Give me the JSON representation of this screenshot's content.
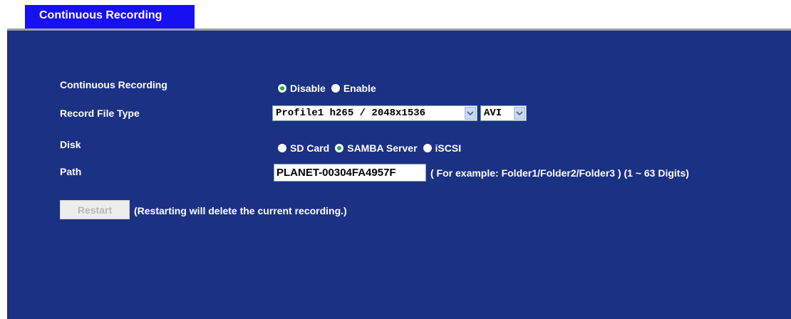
{
  "tab": {
    "title": "Continuous Recording"
  },
  "form": {
    "continuous_recording": {
      "label": "Continuous Recording",
      "options": [
        "Disable",
        "Enable"
      ],
      "selected": "Disable"
    },
    "record_file_type": {
      "label": "Record File Type",
      "profile_value": "Profile1 h265 / 2048x1536",
      "format_value": "AVI"
    },
    "disk": {
      "label": "Disk",
      "options": [
        "SD Card",
        "SAMBA Server",
        "iSCSI"
      ],
      "selected": "SAMBA Server"
    },
    "path": {
      "label": "Path",
      "value": "PLANET-00304FA4957F",
      "hint": "( For example: Folder1/Folder2/Folder3 ) (1 ~ 63 Digits)"
    }
  },
  "restart": {
    "button_label": "Restart",
    "note": "(Restarting will delete the current recording.)"
  },
  "colors": {
    "panel_bg": "#1b3183",
    "tab_bg": "#1810f5",
    "radio_checked": "#11b34a"
  }
}
